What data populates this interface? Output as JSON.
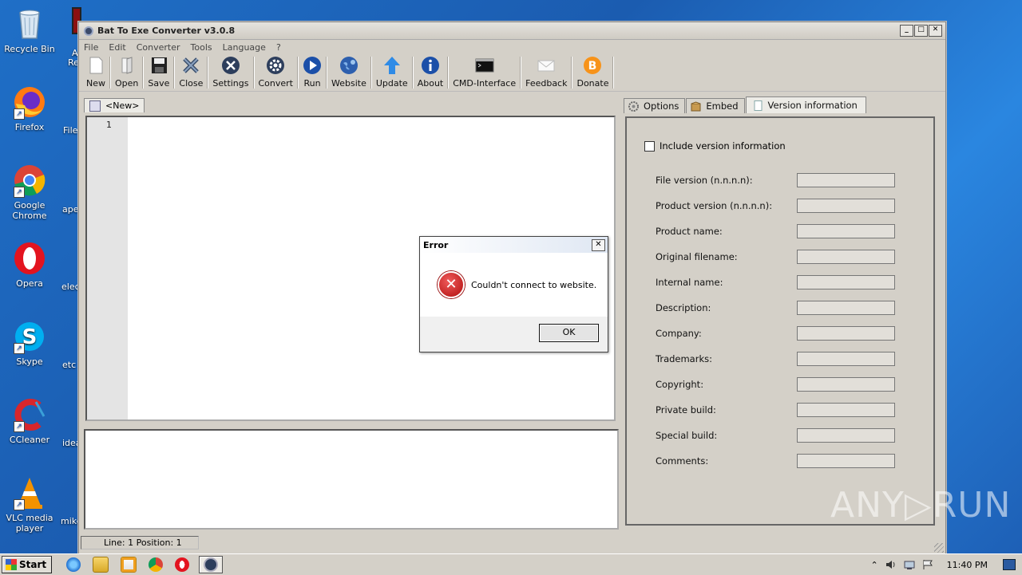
{
  "desktop": {
    "icons": [
      {
        "label": "Recycle Bin"
      },
      {
        "label": "Firefox"
      },
      {
        "label": "Google Chrome"
      },
      {
        "label": "Opera"
      },
      {
        "label": "Skype"
      },
      {
        "label": "CCleaner"
      },
      {
        "label": "VLC media player"
      }
    ],
    "partial_labels": [
      "A",
      "Re",
      "File",
      "ape",
      "elec",
      "etc",
      "idea",
      "mike"
    ]
  },
  "window": {
    "title": "Bat To Exe Converter v3.0.8",
    "controls": {
      "minimize": "_",
      "maximize": "□",
      "close": "✕"
    },
    "menu": [
      "File",
      "Edit",
      "Converter",
      "Tools",
      "Language",
      "?"
    ],
    "toolbar": [
      {
        "label": "New",
        "icon": "new-file-icon"
      },
      {
        "label": "Open",
        "icon": "open-icon"
      },
      {
        "label": "Save",
        "icon": "save-icon"
      },
      {
        "label": "Close",
        "icon": "close-icon"
      },
      {
        "label": "Settings",
        "icon": "settings-icon"
      },
      {
        "label": "Convert",
        "icon": "convert-icon"
      },
      {
        "label": "Run",
        "icon": "run-icon"
      },
      {
        "label": "Website",
        "icon": "globe-icon"
      },
      {
        "label": "Update",
        "icon": "update-arrow-icon"
      },
      {
        "label": "About",
        "icon": "info-icon"
      },
      {
        "label": "CMD-Interface",
        "icon": "terminal-icon"
      },
      {
        "label": "Feedback",
        "icon": "mail-icon"
      },
      {
        "label": "Donate",
        "icon": "bitcoin-icon"
      }
    ],
    "editor": {
      "tab_label": "<New>",
      "line_number": "1"
    },
    "status": {
      "text": "Line: 1  Position: 1"
    },
    "right_tabs": [
      {
        "label": "Options",
        "active": false
      },
      {
        "label": "Embed",
        "active": false
      },
      {
        "label": "Version information",
        "active": true
      }
    ],
    "version_panel": {
      "include_label": "Include version information",
      "include_checked": false,
      "fields": [
        {
          "label": "File version (n.n.n.n):",
          "value": ""
        },
        {
          "label": "Product version (n.n.n.n):",
          "value": ""
        },
        {
          "label": "Product name:",
          "value": ""
        },
        {
          "label": "Original filename:",
          "value": ""
        },
        {
          "label": "Internal name:",
          "value": ""
        },
        {
          "label": "Description:",
          "value": ""
        },
        {
          "label": "Company:",
          "value": ""
        },
        {
          "label": "Trademarks:",
          "value": ""
        },
        {
          "label": "Copyright:",
          "value": ""
        },
        {
          "label": "Private build:",
          "value": ""
        },
        {
          "label": "Special build:",
          "value": ""
        },
        {
          "label": "Comments:",
          "value": ""
        }
      ]
    }
  },
  "dialog": {
    "title": "Error",
    "message": "Couldn't connect to website.",
    "ok_label": "OK",
    "close_glyph": "✕",
    "icon": "error-icon"
  },
  "taskbar": {
    "start_label": "Start",
    "clock": "11:40 PM",
    "tray_glyph": "⌃"
  },
  "watermark": "ANY▷RUN"
}
